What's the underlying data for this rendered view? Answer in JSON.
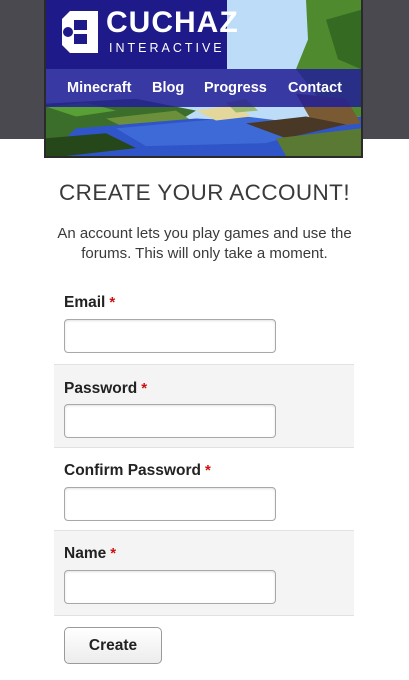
{
  "brand": {
    "title": "CUCHAZ",
    "subtitle": "INTERACTIVE",
    "colors": {
      "logo_bg": "#1e1a8a",
      "nav_bg": "#231e96"
    }
  },
  "nav": {
    "items": [
      {
        "label": "Minecraft"
      },
      {
        "label": "Blog"
      },
      {
        "label": "Progress"
      },
      {
        "label": "Contact"
      }
    ]
  },
  "page": {
    "title": "CREATE YOUR ACCOUNT!",
    "intro": "An account lets you play games and use the forums. This will only take a moment."
  },
  "form": {
    "required_marker": "*",
    "required_color": "#cc1111",
    "fields": [
      {
        "label": "Email",
        "value": "",
        "placeholder": ""
      },
      {
        "label": "Password",
        "value": "",
        "placeholder": ""
      },
      {
        "label": "Confirm Password",
        "value": "",
        "placeholder": ""
      },
      {
        "label": "Name",
        "value": "",
        "placeholder": ""
      }
    ],
    "submit_label": "Create"
  }
}
